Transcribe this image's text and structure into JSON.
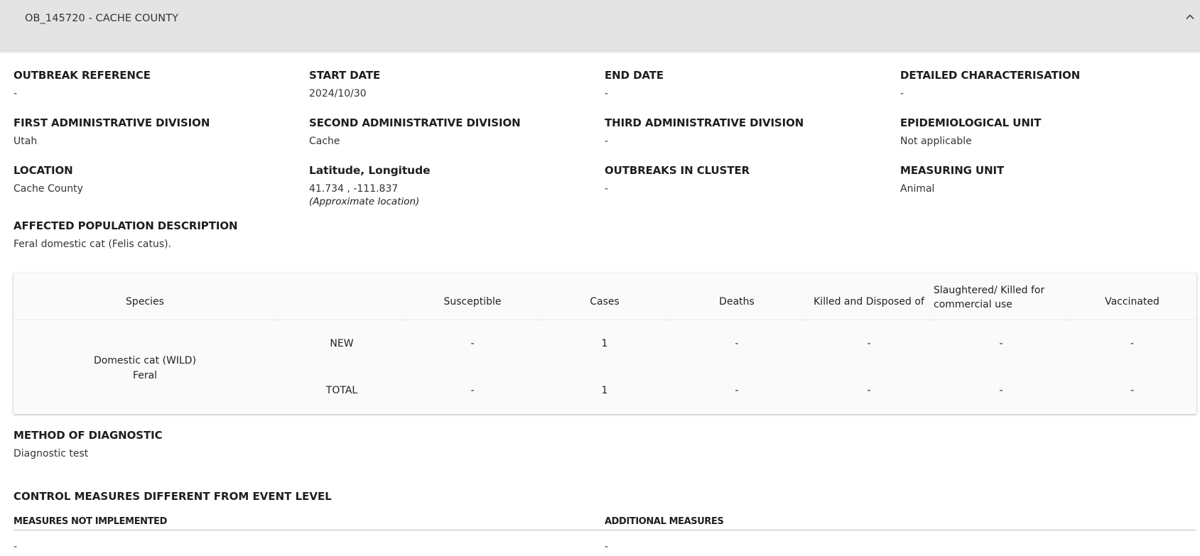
{
  "header": {
    "title": "OB_145720 - CACHE COUNTY",
    "icon": "chevron-up-icon"
  },
  "fields": {
    "outbreak_reference": {
      "label": "OUTBREAK REFERENCE",
      "value": "-"
    },
    "start_date": {
      "label": "START DATE",
      "value": "2024/10/30"
    },
    "end_date": {
      "label": "END DATE",
      "value": "-"
    },
    "detailed_characterisation": {
      "label": "DETAILED CHARACTERISATION",
      "value": "-"
    },
    "first_admin": {
      "label": "FIRST ADMINISTRATIVE DIVISION",
      "value": "Utah"
    },
    "second_admin": {
      "label": "SECOND ADMINISTRATIVE DIVISION",
      "value": "Cache"
    },
    "third_admin": {
      "label": "THIRD ADMINISTRATIVE DIVISION",
      "value": "-"
    },
    "epidemiological_unit": {
      "label": "EPIDEMIOLOGICAL UNIT",
      "value": "Not applicable"
    },
    "location": {
      "label": "LOCATION",
      "value": "Cache County"
    },
    "lat_long": {
      "label": "Latitude, Longitude",
      "value": "41.734 , -111.837",
      "note": "(Approximate location)"
    },
    "outbreaks_in_cluster": {
      "label": "OUTBREAKS IN CLUSTER",
      "value": "-"
    },
    "measuring_unit": {
      "label": "MEASURING UNIT",
      "value": "Animal"
    },
    "affected_population": {
      "label": "AFFECTED POPULATION DESCRIPTION",
      "value": "Feral domestic cat (Felis catus)."
    }
  },
  "table": {
    "headers": {
      "species": "Species",
      "susceptible": "Susceptible",
      "cases": "Cases",
      "deaths": "Deaths",
      "killed": "Killed and Disposed of",
      "slaughtered_line1": "Slaughtered/ Killed for",
      "slaughtered_line2": "commercial use",
      "vaccinated": "Vaccinated"
    },
    "species_line1": "Domestic cat (WILD)",
    "species_line2": "Feral",
    "rows": [
      {
        "label": "NEW",
        "susceptible": "-",
        "cases": "1",
        "deaths": "-",
        "killed": "-",
        "slaughtered": "-",
        "vaccinated": "-"
      },
      {
        "label": "TOTAL",
        "susceptible": "-",
        "cases": "1",
        "deaths": "-",
        "killed": "-",
        "slaughtered": "-",
        "vaccinated": "-"
      }
    ]
  },
  "method_of_diagnostic": {
    "label": "METHOD OF DIAGNOSTIC",
    "value": "Diagnostic test"
  },
  "control_measures": {
    "label": "CONTROL MEASURES DIFFERENT FROM EVENT LEVEL",
    "not_implemented": {
      "label": "MEASURES NOT IMPLEMENTED",
      "value": "-"
    },
    "additional": {
      "label": "ADDITIONAL MEASURES",
      "value": "-"
    }
  }
}
